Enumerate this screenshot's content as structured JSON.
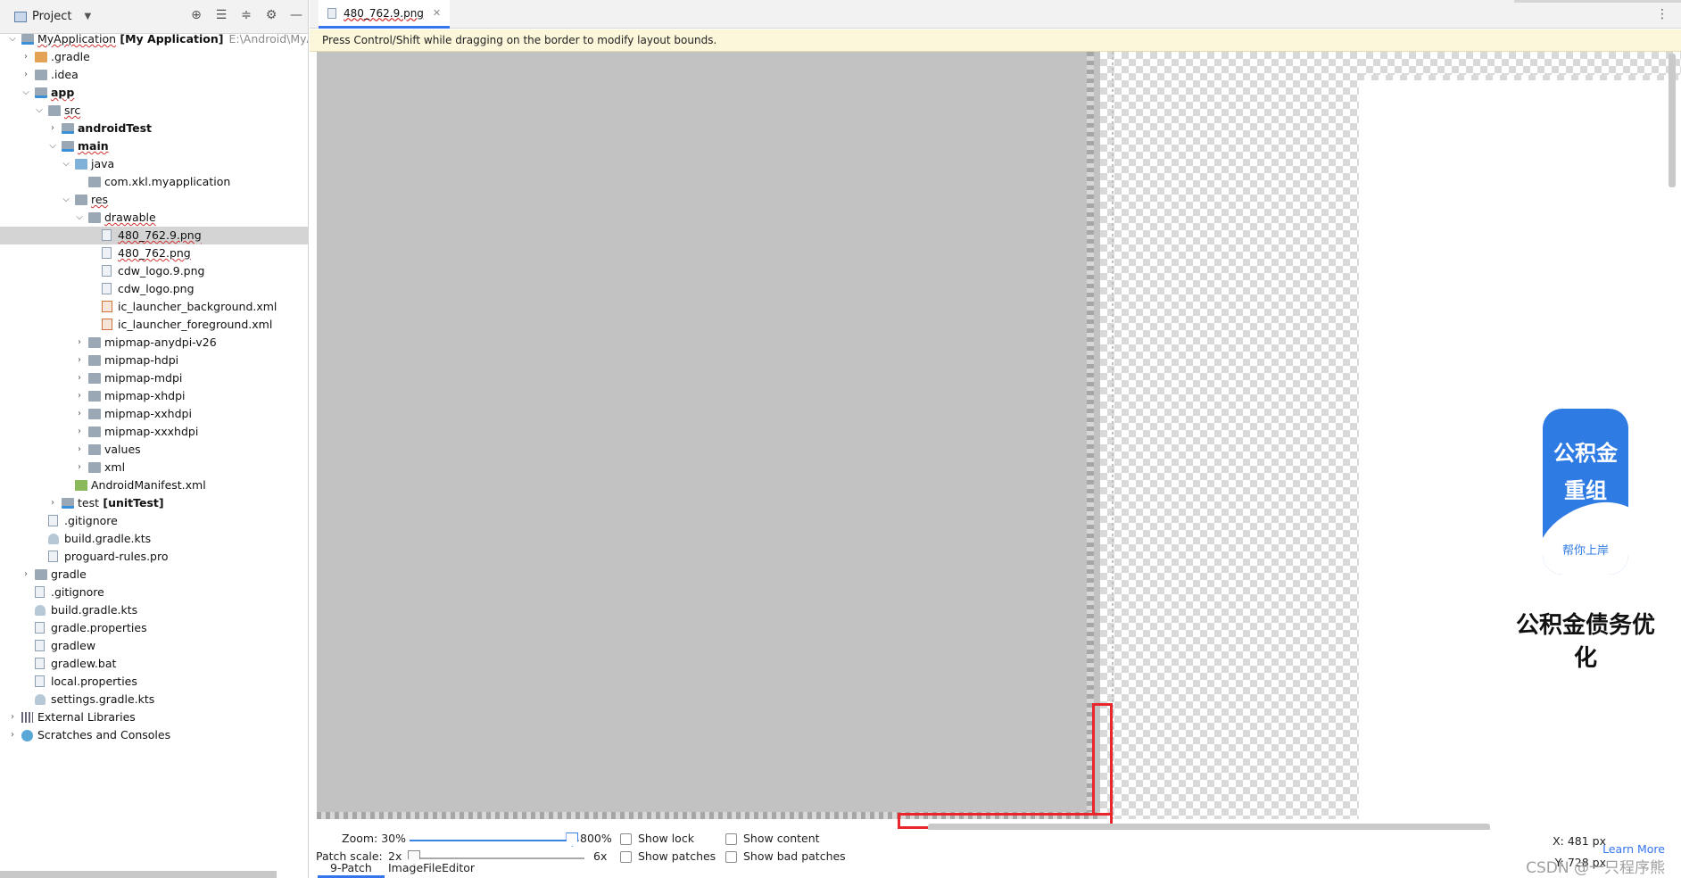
{
  "project_panel": {
    "title": "Project",
    "tree": [
      {
        "label": "MyApplication",
        "suffix": "[My Application]",
        "path": "E:\\Android\\MyAp",
        "depth": 0,
        "chevron": "open",
        "icon": "module-icon",
        "bold_suffix": true,
        "underline": true
      },
      {
        "label": ".gradle",
        "depth": 1,
        "chevron": "closed",
        "icon": "folder-orange"
      },
      {
        "label": ".idea",
        "depth": 1,
        "chevron": "closed",
        "icon": "folder"
      },
      {
        "label": "app",
        "depth": 1,
        "chevron": "open",
        "icon": "folder-module",
        "bold": true,
        "underline": true
      },
      {
        "label": "src",
        "depth": 2,
        "chevron": "open",
        "icon": "folder",
        "underline": true
      },
      {
        "label": "androidTest",
        "depth": 3,
        "chevron": "closed",
        "icon": "folder-module",
        "bold": true
      },
      {
        "label": "main",
        "depth": 3,
        "chevron": "open",
        "icon": "folder-module",
        "bold": true,
        "underline": true
      },
      {
        "label": "java",
        "depth": 4,
        "chevron": "open",
        "icon": "folder-blue"
      },
      {
        "label": "com.xkl.myapplication",
        "depth": 5,
        "chevron": "none",
        "icon": "folder"
      },
      {
        "label": "res",
        "depth": 4,
        "chevron": "open",
        "icon": "folder",
        "underline": true
      },
      {
        "label": "drawable",
        "depth": 5,
        "chevron": "open",
        "icon": "folder",
        "underline": true
      },
      {
        "label": "480_762.9.png",
        "depth": 6,
        "chevron": "none",
        "icon": "file",
        "selected": true,
        "underline": true
      },
      {
        "label": "480_762.png",
        "depth": 6,
        "chevron": "none",
        "icon": "file",
        "underline": true
      },
      {
        "label": "cdw_logo.9.png",
        "depth": 6,
        "chevron": "none",
        "icon": "file"
      },
      {
        "label": "cdw_logo.png",
        "depth": 6,
        "chevron": "none",
        "icon": "file"
      },
      {
        "label": "ic_launcher_background.xml",
        "depth": 6,
        "chevron": "none",
        "icon": "xml"
      },
      {
        "label": "ic_launcher_foreground.xml",
        "depth": 6,
        "chevron": "none",
        "icon": "xml"
      },
      {
        "label": "mipmap-anydpi-v26",
        "depth": 5,
        "chevron": "closed",
        "icon": "folder"
      },
      {
        "label": "mipmap-hdpi",
        "depth": 5,
        "chevron": "closed",
        "icon": "folder"
      },
      {
        "label": "mipmap-mdpi",
        "depth": 5,
        "chevron": "closed",
        "icon": "folder"
      },
      {
        "label": "mipmap-xhdpi",
        "depth": 5,
        "chevron": "closed",
        "icon": "folder"
      },
      {
        "label": "mipmap-xxhdpi",
        "depth": 5,
        "chevron": "closed",
        "icon": "folder"
      },
      {
        "label": "mipmap-xxxhdpi",
        "depth": 5,
        "chevron": "closed",
        "icon": "folder"
      },
      {
        "label": "values",
        "depth": 5,
        "chevron": "closed",
        "icon": "folder"
      },
      {
        "label": "xml",
        "depth": 5,
        "chevron": "closed",
        "icon": "folder"
      },
      {
        "label": "AndroidManifest.xml",
        "depth": 4,
        "chevron": "none",
        "icon": "manifest"
      },
      {
        "label": "test",
        "suffix": "[unitTest]",
        "depth": 3,
        "chevron": "closed",
        "icon": "folder-module",
        "bold_suffix": true
      },
      {
        "label": ".gitignore",
        "depth": 2,
        "chevron": "none",
        "icon": "file"
      },
      {
        "label": "build.gradle.kts",
        "depth": 2,
        "chevron": "none",
        "icon": "gradle"
      },
      {
        "label": "proguard-rules.pro",
        "depth": 2,
        "chevron": "none",
        "icon": "file"
      },
      {
        "label": "gradle",
        "depth": 1,
        "chevron": "closed",
        "icon": "folder"
      },
      {
        "label": ".gitignore",
        "depth": 1,
        "chevron": "none",
        "icon": "file"
      },
      {
        "label": "build.gradle.kts",
        "depth": 1,
        "chevron": "none",
        "icon": "gradle"
      },
      {
        "label": "gradle.properties",
        "depth": 1,
        "chevron": "none",
        "icon": "file"
      },
      {
        "label": "gradlew",
        "depth": 1,
        "chevron": "none",
        "icon": "file"
      },
      {
        "label": "gradlew.bat",
        "depth": 1,
        "chevron": "none",
        "icon": "file"
      },
      {
        "label": "local.properties",
        "depth": 1,
        "chevron": "none",
        "icon": "file"
      },
      {
        "label": "settings.gradle.kts",
        "depth": 1,
        "chevron": "none",
        "icon": "gradle"
      },
      {
        "label": "External Libraries",
        "depth": 0,
        "chevron": "closed",
        "icon": "lib"
      },
      {
        "label": "Scratches and Consoles",
        "depth": 0,
        "chevron": "closed",
        "icon": "scratch"
      }
    ]
  },
  "editor": {
    "tab_label": "480_762.9.png",
    "hint": "Press Control/Shift while dragging on the border to modify layout bounds."
  },
  "image": {
    "logo_line1": "公积金",
    "logo_line2": "重组",
    "logo_line3": "帮你上岸",
    "caption": "公积金债务优化"
  },
  "controls": {
    "zoom_label": "Zoom: 30%",
    "zoom_max": "800%",
    "zoom_fraction": 0.96,
    "patch_scale_label": "Patch scale:",
    "patch_min": "2x",
    "patch_max": "6x",
    "patch_fraction": 0.0,
    "show_lock": "Show lock",
    "show_patches": "Show patches",
    "show_content": "Show content",
    "show_bad_patches": "Show bad patches",
    "x_readout": "X: 481 px",
    "y_readout": "Y: 728 px",
    "learn_more": "Learn More"
  },
  "bottom_tabs": {
    "ninepatch": "9-Patch",
    "image_editor": "ImageFileEditor"
  },
  "watermark": "CSDN @一只程序熊",
  "colors": {
    "accent": "#3574f0",
    "highlight_red": "#e8262b",
    "logo_blue": "#2f7be4"
  }
}
